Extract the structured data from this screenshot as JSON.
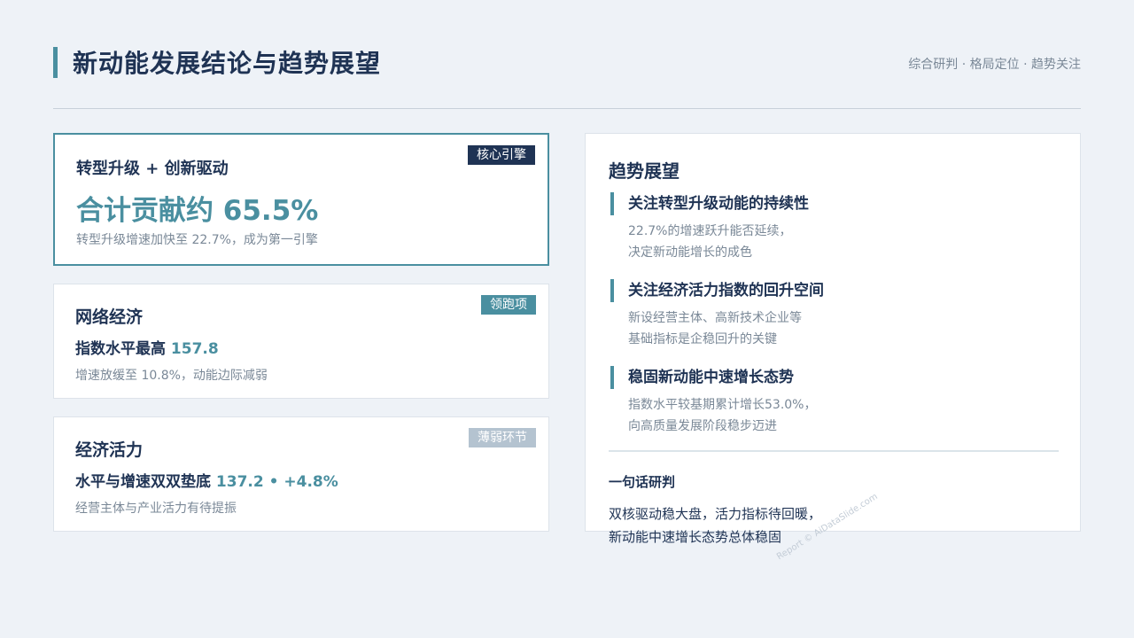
{
  "header": {
    "title": "新动能发展结论与趋势展望",
    "subtitle": "综合研判 · 格局定位 · 趋势关注"
  },
  "cards": {
    "core": {
      "tag": "核心引擎",
      "title": "转型升级 + 创新驱动",
      "metric": "合计贡献约 65.5%",
      "desc": "转型升级增速加快至 22.7%，成为第一引擎",
      "tag_color": "#1f3354"
    },
    "network": {
      "tag": "领跑项",
      "title": "网络经济",
      "metric_label": "指数水平最高",
      "metric_value": "157.8",
      "desc": "增速放缓至 10.8%，动能边际减弱",
      "tag_color": "#4a8fa0"
    },
    "vitality": {
      "tag": "薄弱环节",
      "title": "经济活力",
      "metric_label": "水平与增速双双垫底",
      "metric_value": "137.2 • +4.8%",
      "desc": "经营主体与产业活力有待提振",
      "tag_color": "#b4c3d0"
    }
  },
  "outlook": {
    "title": "趋势展望",
    "points": [
      {
        "title": "关注转型升级动能的持续性",
        "line1": "22.7%的增速跃升能否延续，",
        "line2": "决定新动能增长的成色"
      },
      {
        "title": "关注经济活力指数的回升空间",
        "line1": "新设经营主体、高新技术企业等",
        "line2": "基础指标是企稳回升的关键"
      },
      {
        "title": "稳固新动能中速增长态势",
        "line1": "指数水平较基期累计增长53.0%，",
        "line2": "向高质量发展阶段稳步迈进"
      }
    ],
    "summary_label": "一句话研判",
    "summary_line1": "双核驱动稳大盘，活力指标待回暖，",
    "summary_line2": "新动能中速增长态势总体稳固"
  },
  "watermark": "Report © AiDataSlide.com",
  "colors": {
    "accent": "#4a8fa0",
    "navy": "#1f3354",
    "muted": "#7a8897",
    "bg": "#eef2f7"
  }
}
